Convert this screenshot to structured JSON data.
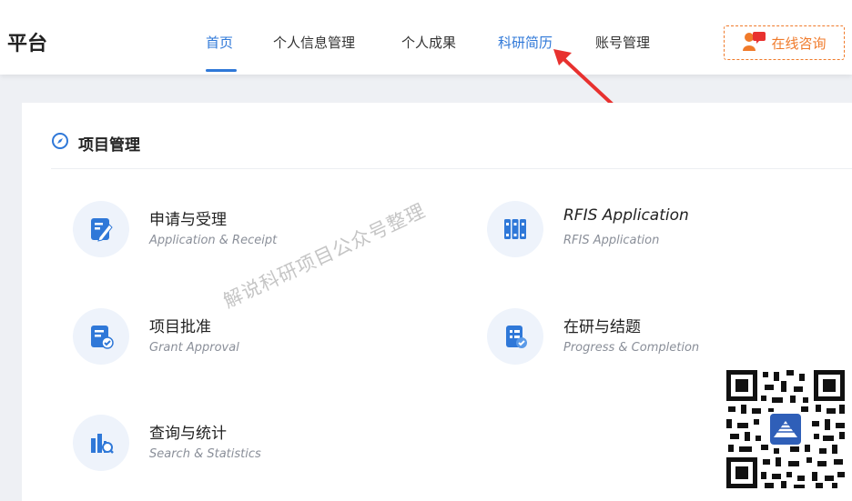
{
  "header": {
    "brand": "平台",
    "nav": [
      {
        "label": "首页"
      },
      {
        "label": "个人信息管理"
      },
      {
        "label": "个人成果"
      },
      {
        "label": "科研简历"
      },
      {
        "label": "账号管理"
      }
    ],
    "consult_label": "在线咨询"
  },
  "panel": {
    "title": "项目管理",
    "cards": [
      {
        "title": "申请与受理",
        "subtitle": "Application & Receipt",
        "icon": "edit-form-icon"
      },
      {
        "title": "RFIS Application",
        "subtitle": "RFIS Application",
        "icon": "archive-binder-icon"
      },
      {
        "title": "项目批准",
        "subtitle": "Grant Approval",
        "icon": "approval-document-icon"
      },
      {
        "title": "在研与结题",
        "subtitle": "Progress & Completion",
        "icon": "progress-checklist-icon"
      },
      {
        "title": "查询与统计",
        "subtitle": "Search & Statistics",
        "icon": "search-chart-icon"
      }
    ]
  },
  "watermark": "解说科研项目公众号整理",
  "colors": {
    "accent": "#2f78d8",
    "consult": "#f07a2a",
    "arrow": "#e8312f"
  }
}
